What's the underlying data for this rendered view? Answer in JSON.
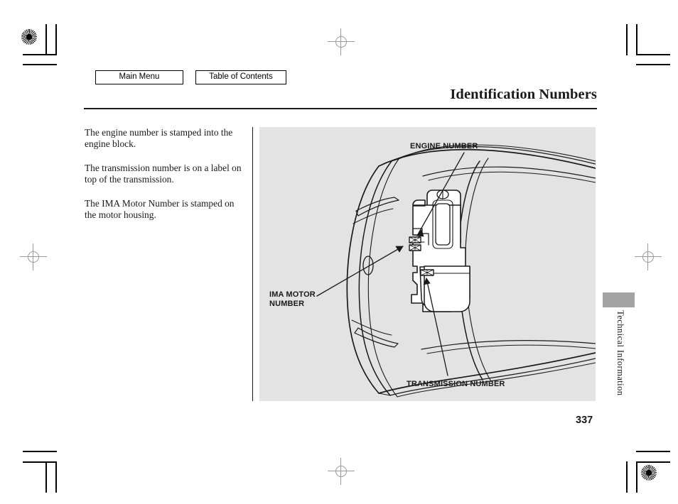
{
  "nav": {
    "main_menu": "Main Menu",
    "table_of_contents": "Table of Contents"
  },
  "header": {
    "title": "Identification Numbers"
  },
  "body": {
    "paragraphs": [
      "The engine number is stamped into the engine block.",
      "The transmission number is on a label on top of the transmission.",
      "The IMA Motor Number is stamped on the motor housing."
    ]
  },
  "figure": {
    "caption_engine": "ENGINE NUMBER",
    "caption_ima": "IMA MOTOR\nNUMBER",
    "caption_transmission": "TRANSMISSION NUMBER",
    "background_color": "#e3e3e3",
    "line_color": "#1a1a1a"
  },
  "side_tab": {
    "label": "Technical Information",
    "tab_color": "#a3a3a3"
  },
  "footer": {
    "page_number": "337"
  },
  "print_marks": {
    "registration": "registration-rosette",
    "crosshair": "crosshair-mark"
  }
}
